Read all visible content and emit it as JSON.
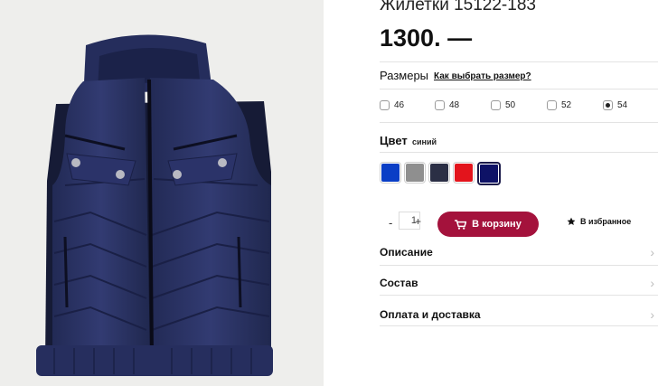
{
  "product": {
    "title": "Жилетки 15122-183",
    "price": "1300. —"
  },
  "sizes": {
    "label": "Размеры",
    "guide_link": "Как выбрать размер?",
    "options": [
      {
        "label": "46",
        "checked": false
      },
      {
        "label": "48",
        "checked": false
      },
      {
        "label": "50",
        "checked": false
      },
      {
        "label": "52",
        "checked": false
      },
      {
        "label": "54",
        "checked": true
      }
    ]
  },
  "color": {
    "label": "Цвет",
    "selected_name": "синий",
    "swatches": [
      {
        "hex": "#0a3ec6",
        "active": false
      },
      {
        "hex": "#8f8f8f",
        "active": false
      },
      {
        "hex": "#2b2f45",
        "active": false
      },
      {
        "hex": "#e3141c",
        "active": false
      },
      {
        "hex": "#0e1266",
        "active": true
      }
    ]
  },
  "cart": {
    "minus": "-",
    "quantity": "1",
    "plus": "+",
    "button_label": "В корзину",
    "button_icon": "cart-icon",
    "favorites_icon": "star-icon",
    "favorites_label": "В избранное"
  },
  "accordion": [
    {
      "label": "Описание",
      "icon": "chevron-right-icon"
    },
    {
      "label": "Состав",
      "icon": "chevron-right-icon"
    },
    {
      "label": "Оплата и доставка",
      "icon": "chevron-right-icon"
    }
  ],
  "colors": {
    "accent": "#a4123c",
    "vest": "#2c3466"
  }
}
